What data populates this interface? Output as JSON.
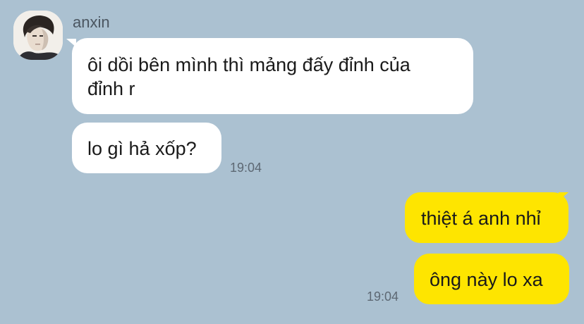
{
  "chat": {
    "sender_name": "anxin",
    "incoming": [
      {
        "line1": "ôi dồi bên mình thì mảng đấy đỉnh của",
        "line2": "đỉnh r"
      },
      {
        "text": "lo gì hả xốp?"
      }
    ],
    "incoming_time": "19:04",
    "outgoing": [
      {
        "text": "thiệt á anh nhỉ"
      },
      {
        "text": "ông này lo xa"
      }
    ],
    "outgoing_time": "19:04"
  },
  "colors": {
    "background": "#abc1d1",
    "incoming_bubble": "#ffffff",
    "outgoing_bubble": "#fee500"
  },
  "icons": {
    "avatar": "profile-photo"
  }
}
